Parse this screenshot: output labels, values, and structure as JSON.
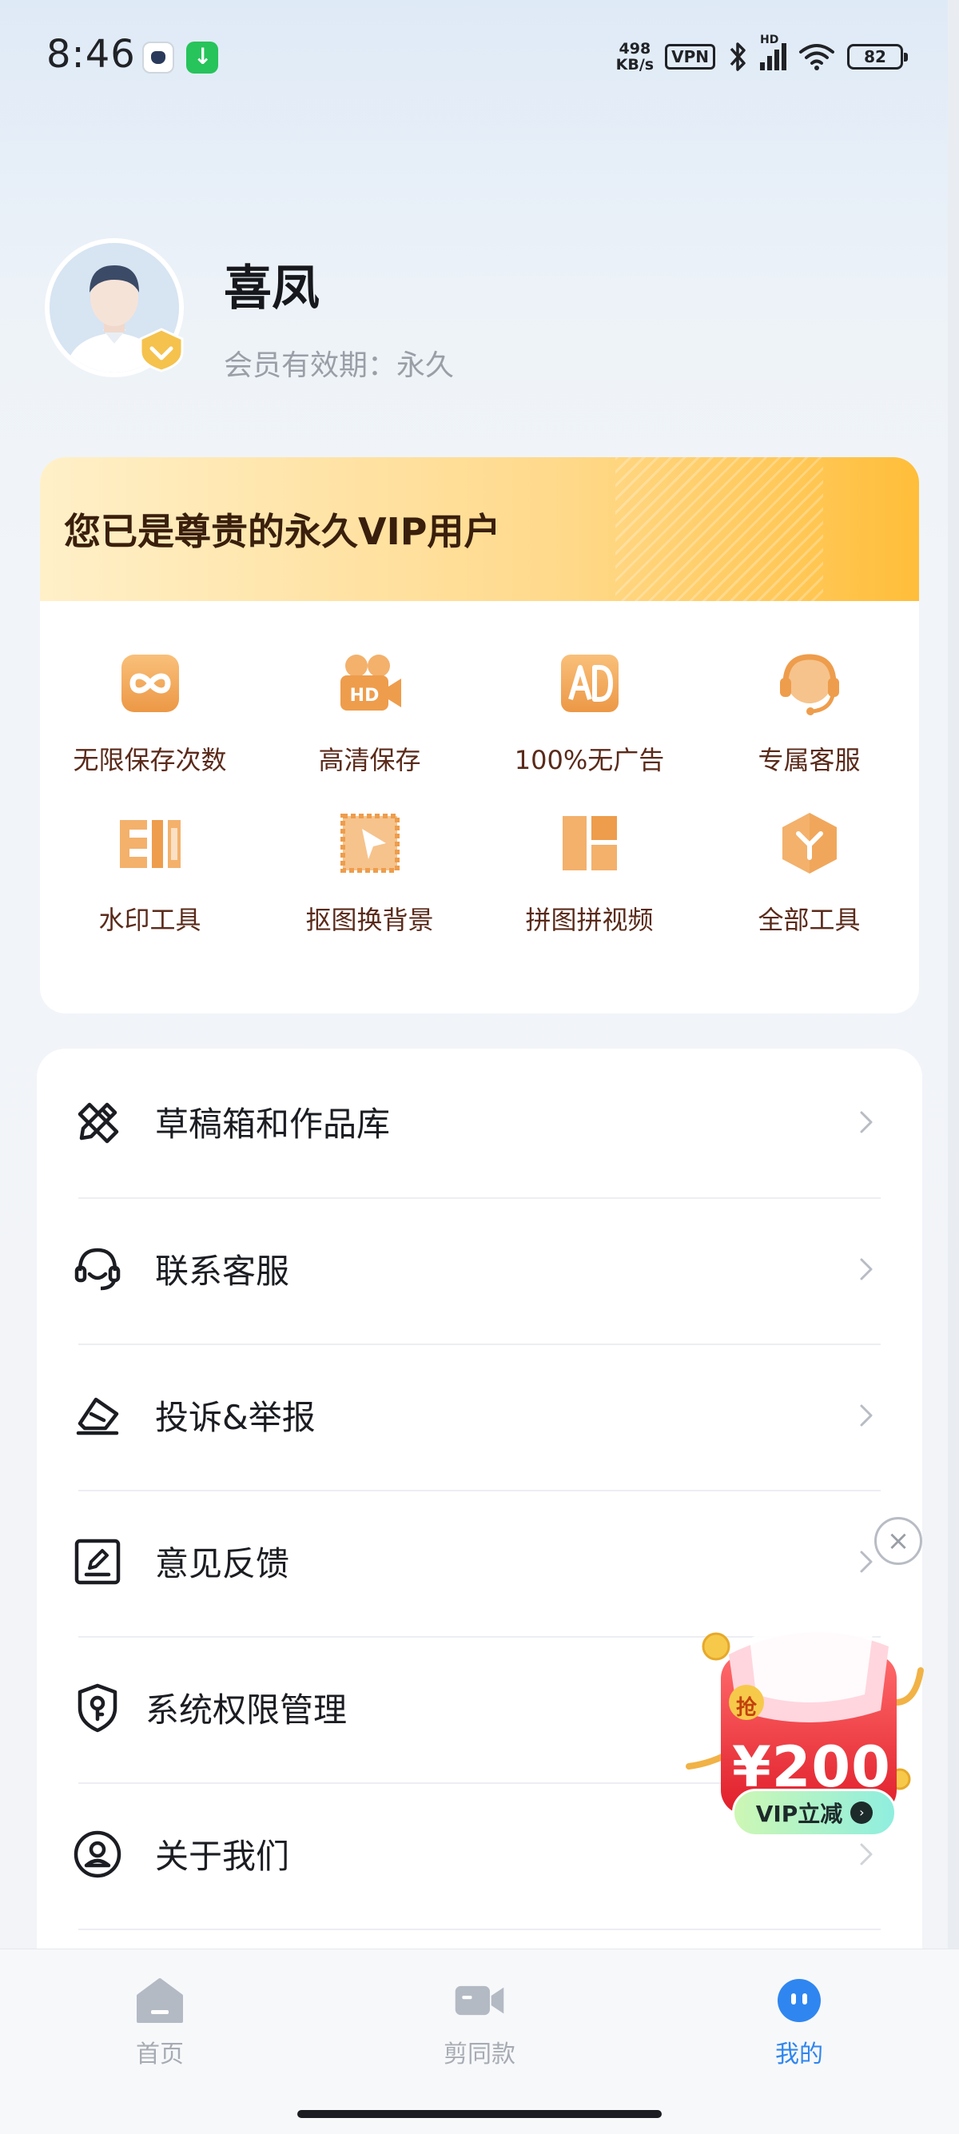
{
  "status_bar": {
    "time": "8:46",
    "net_speed_value": "498",
    "net_speed_unit": "KB/s",
    "vpn_label": "VPN",
    "network_label": "HD",
    "battery": "82",
    "icons": [
      "cat-app-icon",
      "download-app-icon",
      "bluetooth-icon",
      "signal-icon",
      "wifi-icon",
      "battery-icon"
    ]
  },
  "profile": {
    "name": "喜凤",
    "member_expiry": "会员有效期：永久"
  },
  "vip": {
    "title": "您已是尊贵的永久VIP用户",
    "accent": "#f0a64a",
    "benefits": [
      {
        "label": "无限保存次数",
        "icon": "infinity-icon"
      },
      {
        "label": "高清保存",
        "icon": "hd-camera-icon"
      },
      {
        "label": "100%无广告",
        "icon": "no-ad-icon"
      },
      {
        "label": "专属客服",
        "icon": "headset-icon"
      },
      {
        "label": "水印工具",
        "icon": "watermark-icon"
      },
      {
        "label": "抠图换背景",
        "icon": "cutout-icon"
      },
      {
        "label": "拼图拼视频",
        "icon": "collage-icon"
      },
      {
        "label": "全部工具",
        "icon": "all-tools-icon"
      }
    ]
  },
  "menu": {
    "items": [
      {
        "label": "草稿箱和作品库",
        "icon": "pencil-ruler-icon"
      },
      {
        "label": "联系客服",
        "icon": "customer-service-icon"
      },
      {
        "label": "投诉&举报",
        "icon": "report-icon"
      },
      {
        "label": "意见反馈",
        "icon": "feedback-icon"
      },
      {
        "label": "系统权限管理",
        "icon": "shield-key-icon"
      },
      {
        "label": "关于我们",
        "icon": "about-user-icon"
      }
    ]
  },
  "promo": {
    "badge": "抢",
    "amount": "¥200",
    "cta": "VIP立减"
  },
  "bottom_nav": {
    "items": [
      {
        "label": "首页",
        "icon": "home-icon",
        "active": false
      },
      {
        "label": "剪同款",
        "icon": "video-camera-icon",
        "active": false
      },
      {
        "label": "我的",
        "icon": "profile-face-icon",
        "active": true
      }
    ],
    "active_color": "#2f86f0",
    "inactive_color": "#a7abb3"
  }
}
